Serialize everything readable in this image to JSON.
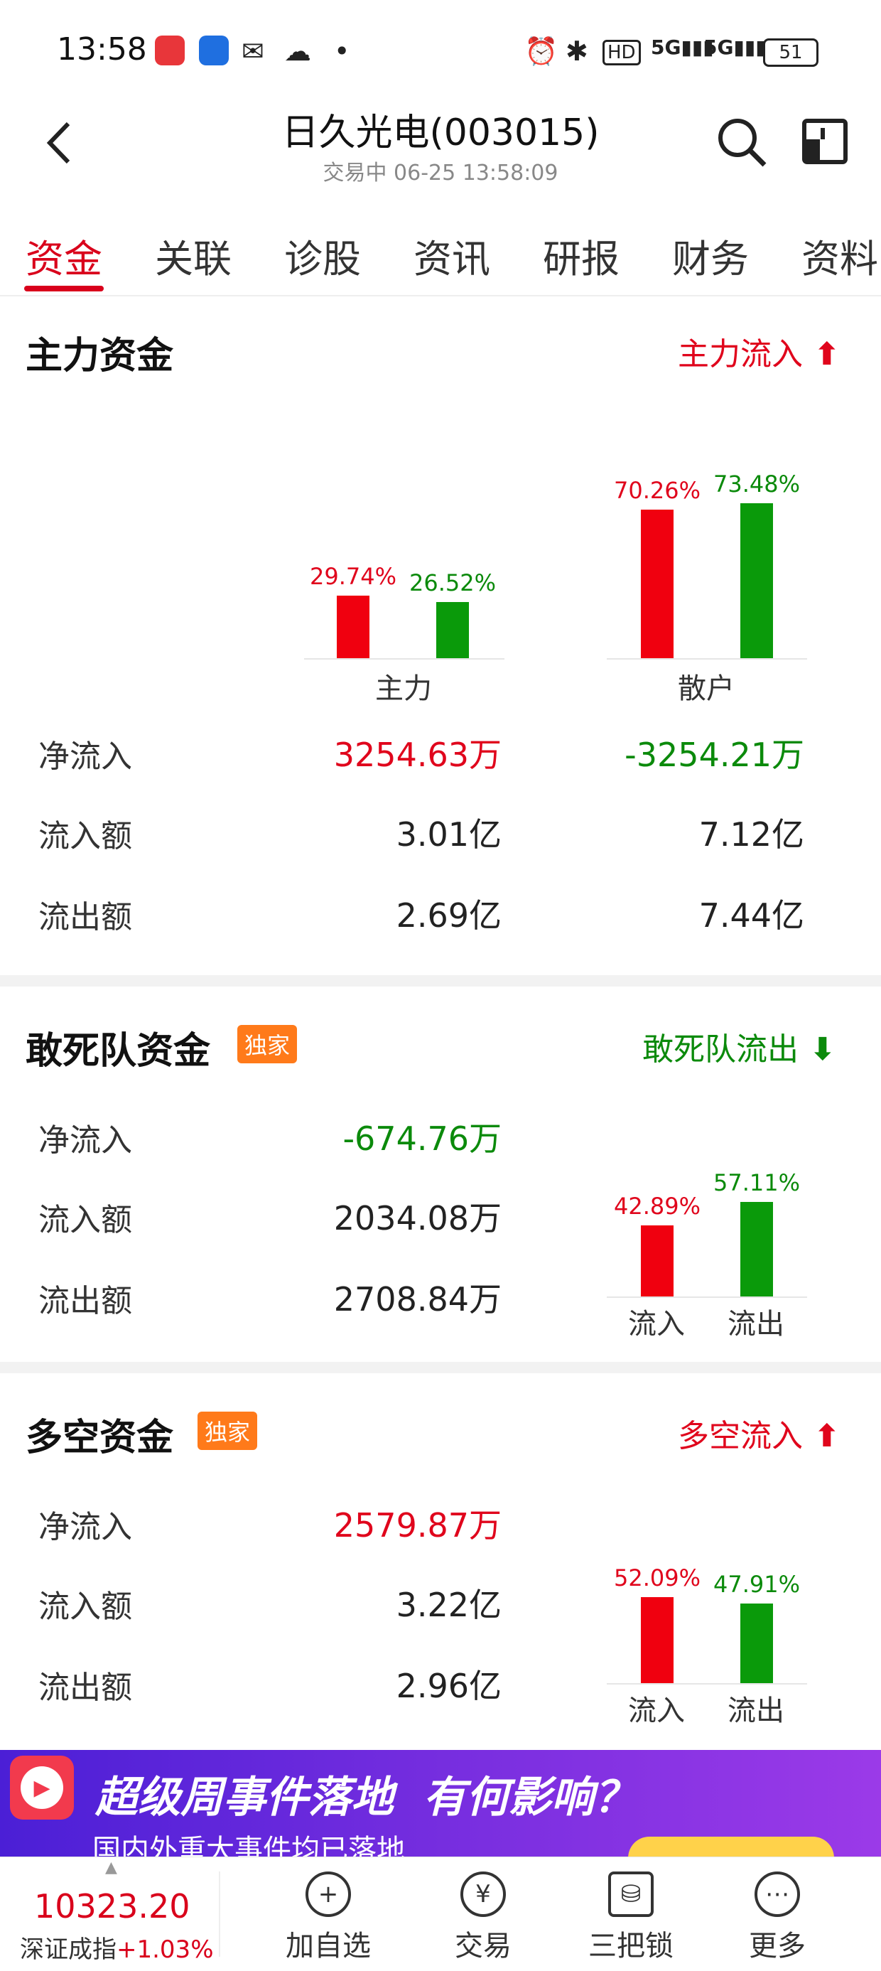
{
  "status_bar": {
    "time": "13:58",
    "battery": "51"
  },
  "header": {
    "title": "日久光电(003015)",
    "subtitle": "交易中 06-25 13:58:09"
  },
  "tabs": [
    "资金",
    "关联",
    "诊股",
    "资讯",
    "研报",
    "财务",
    "资料"
  ],
  "main_funds": {
    "title": "主力资金",
    "flow_label": "主力流入",
    "chart_data": {
      "type": "bar",
      "categories": [
        "主力",
        "散户"
      ],
      "series": [
        {
          "name": "流入",
          "values": [
            29.74,
            70.26
          ],
          "labels": [
            "29.74%",
            "70.26%"
          ],
          "color": "#f0000f"
        },
        {
          "name": "流出",
          "values": [
            26.52,
            73.48
          ],
          "labels": [
            "26.52%",
            "73.48%"
          ],
          "color": "#0a9a0a"
        }
      ]
    },
    "rows": [
      {
        "label": "净流入",
        "main": "3254.63万",
        "retail": "-3254.21万"
      },
      {
        "label": "流入额",
        "main": "3.01亿",
        "retail": "7.12亿"
      },
      {
        "label": "流出额",
        "main": "2.69亿",
        "retail": "7.44亿"
      }
    ]
  },
  "dare_funds": {
    "title": "敢死队资金",
    "badge": "独家",
    "flow_label": "敢死队流出",
    "rows": [
      {
        "label": "净流入",
        "value": "-674.76万"
      },
      {
        "label": "流入额",
        "value": "2034.08万"
      },
      {
        "label": "流出额",
        "value": "2708.84万"
      }
    ],
    "chart_data": {
      "type": "bar",
      "categories": [
        "流入",
        "流出"
      ],
      "values": [
        42.89,
        57.11
      ],
      "labels": [
        "42.89%",
        "57.11%"
      ]
    }
  },
  "longshort_funds": {
    "title": "多空资金",
    "badge": "独家",
    "flow_label": "多空流入",
    "rows": [
      {
        "label": "净流入",
        "value": "2579.87万"
      },
      {
        "label": "流入额",
        "value": "3.22亿"
      },
      {
        "label": "流出额",
        "value": "2.96亿"
      }
    ],
    "chart_data": {
      "type": "bar",
      "categories": [
        "流入",
        "流出"
      ],
      "values": [
        52.09,
        47.91
      ],
      "labels": [
        "52.09%",
        "47.91%"
      ]
    }
  },
  "banner": {
    "headline": "超级周事件落地  有何影响？",
    "subline": "国内外重大事件均已落地"
  },
  "bottom": {
    "index_value": "10323.20",
    "index_name": "深证成指",
    "index_change": "+1.03%",
    "nav": [
      "加自选",
      "交易",
      "三把锁",
      "更多"
    ]
  },
  "colors": {
    "red": "#e0051c",
    "green": "#0b8a0b",
    "accent": "#d9001b"
  }
}
